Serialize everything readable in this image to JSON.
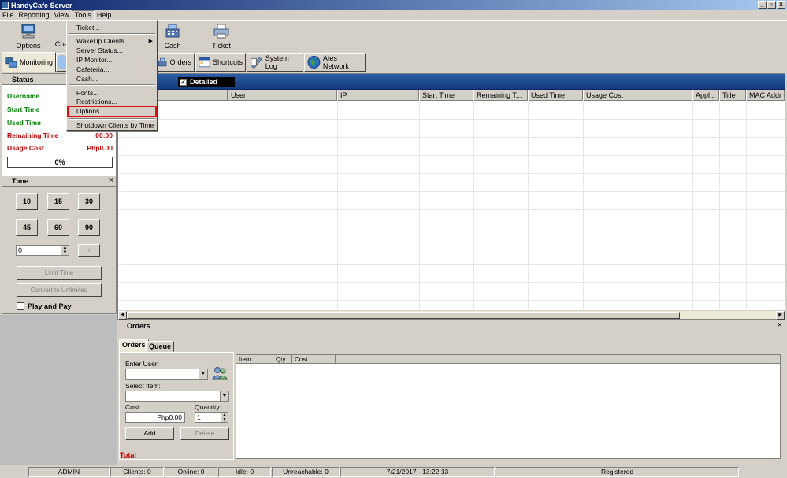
{
  "window": {
    "title": "HandyCafe Server",
    "controls": {
      "minimize": "_",
      "restore": "▫",
      "close": "×"
    }
  },
  "menubar": [
    "File",
    "Reporting",
    "View",
    "Tools",
    "Help"
  ],
  "toolbar": {
    "options": "Options",
    "change": "Cha",
    "cash": "Cash",
    "ticket": "Ticket"
  },
  "tabs": {
    "monitoring": "Monitoring",
    "orders": "Orders",
    "shortcuts": "Shortcuts",
    "system_log": "System Log",
    "ates_network": "Ates Network"
  },
  "tools_menu": {
    "ticket": "Ticket...",
    "wakeup": "WakeUp Clients",
    "server_status": "Server Status...",
    "ip_monitor": "IP Monitor...",
    "cafeteria": "Cafeteria...",
    "cash": "Cash...",
    "fonts": "Fonts...",
    "restrictions": "Restrictions...",
    "options": "Options...",
    "shutdown": "Shutdown Clients by Time",
    "submenu_arrow": "▶"
  },
  "status_panel": {
    "title": "Status",
    "username_label": "Username",
    "start_time_label": "Start Time",
    "used_time_label": "Used Time",
    "remaining_time_label": "Remaining Time",
    "remaining_time_value": "00:00",
    "usage_cost_label": "Usage Cost",
    "usage_cost_value": "Php0.00",
    "progress": "0%"
  },
  "time_panel": {
    "title": "Time",
    "buttons": [
      "10",
      "15",
      "30",
      "45",
      "60",
      "90"
    ],
    "spin_value": "0",
    "plus": "+",
    "limit_time": "Limit Time",
    "convert": "Convert to Unlimited",
    "play_and_pay": "Play and Pay"
  },
  "grid": {
    "detailed_label": "Detailed",
    "columns": [
      "User",
      "IP",
      "Start Time",
      "Remaining T...",
      "Used Time",
      "Usage Cost",
      "Appl...",
      "Title",
      "MAC Addr"
    ]
  },
  "orders": {
    "title": "Orders",
    "tabs": [
      "Orders",
      "Queue"
    ],
    "enter_user": "Enter User:",
    "select_item": "Select Item:",
    "cost_label": "Cost:",
    "cost_value": "Php0.00",
    "quantity_label": "Quantity:",
    "quantity_value": "1",
    "add": "Add",
    "delete": "Delete",
    "total": "Total",
    "list_columns": [
      "Item",
      "Qty",
      "Cost"
    ]
  },
  "statusbar": {
    "user": "ADMIN",
    "clients": "Clients: 0",
    "online": "Online: 0",
    "idle": "Idle: 0",
    "unreachable": "Unreachable: 0",
    "datetime": "7/21/2017 - 13:22:13",
    "registered": "Registered"
  },
  "colors": {
    "title_bar": "#0a246a",
    "banner": "#2a5da8",
    "green_label": "#008000",
    "red_label": "#c00000",
    "highlight_border": "#dd1111"
  }
}
